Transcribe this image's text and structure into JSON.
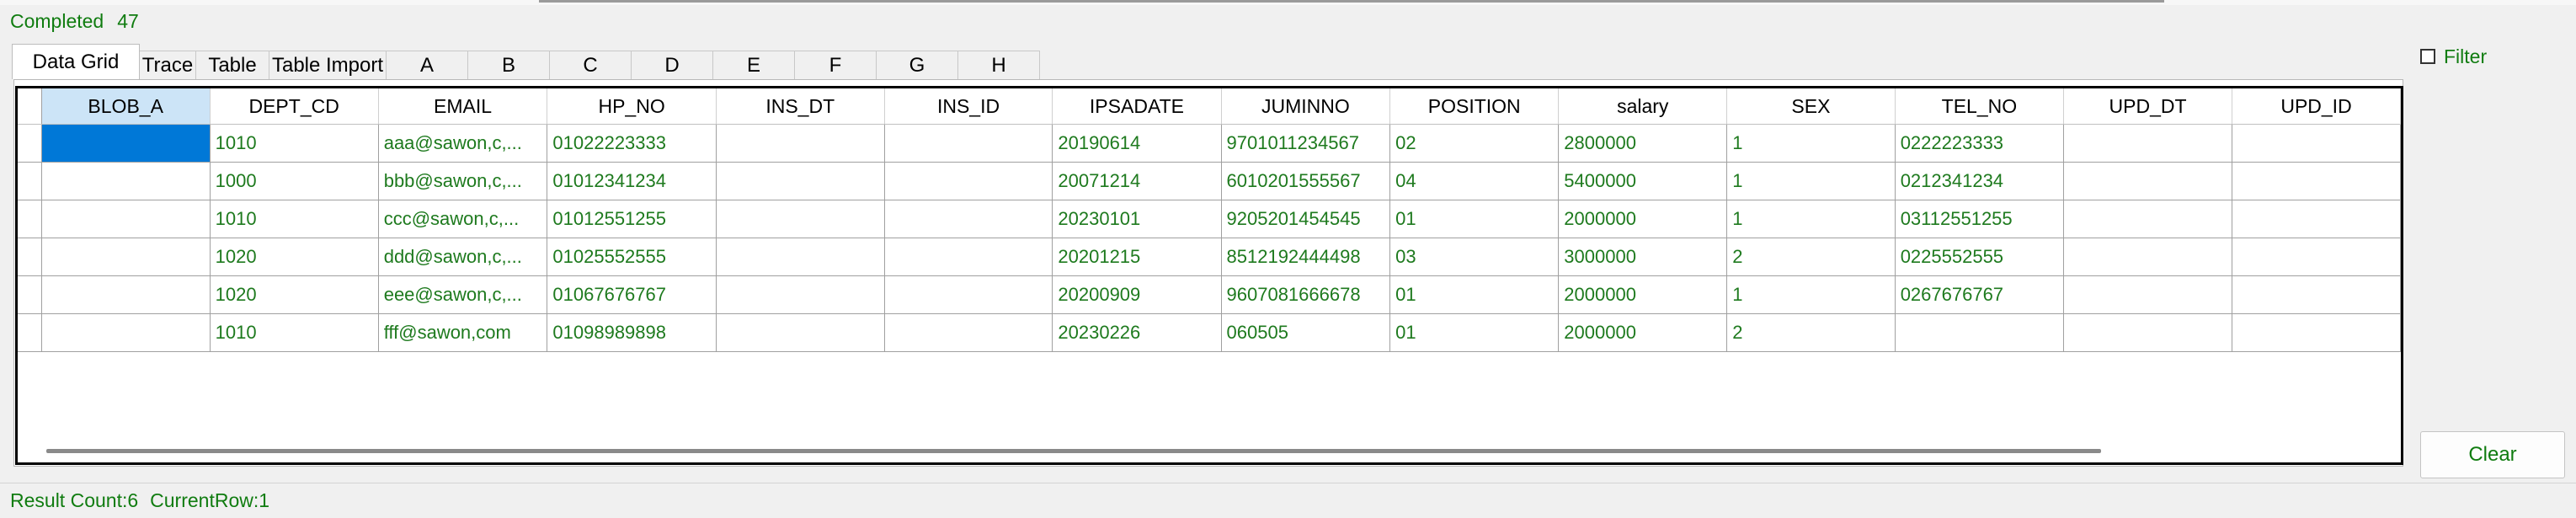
{
  "status_top": {
    "state": "Completed",
    "count": "47"
  },
  "tabs": [
    "Data Grid",
    "Trace",
    "Table",
    "Table Import",
    "A",
    "B",
    "C",
    "D",
    "E",
    "F",
    "G",
    "H"
  ],
  "active_tab": "Data Grid",
  "filter": {
    "label": "Filter",
    "checked": false
  },
  "grid": {
    "columns": [
      "BLOB_A",
      "DEPT_CD",
      "EMAIL",
      "HP_NO",
      "INS_DT",
      "INS_ID",
      "IPSADATE",
      "JUMINNO",
      "POSITION",
      "salary",
      "SEX",
      "TEL_NO",
      "UPD_DT",
      "UPD_ID"
    ],
    "rows": [
      [
        "",
        "1010",
        "aaa@sawon,c,...",
        "01022223333",
        "",
        "",
        "20190614",
        "9701011234567",
        "02",
        "2800000",
        "1",
        "0222223333",
        "",
        ""
      ],
      [
        "",
        "1000",
        "bbb@sawon,c,...",
        "01012341234",
        "",
        "",
        "20071214",
        "6010201555567",
        "04",
        "5400000",
        "1",
        "0212341234",
        "",
        ""
      ],
      [
        "",
        "1010",
        "ccc@sawon,c,...",
        "01012551255",
        "",
        "",
        "20230101",
        "9205201454545",
        "01",
        "2000000",
        "1",
        "03112551255",
        "",
        ""
      ],
      [
        "",
        "1020",
        "ddd@sawon,c,...",
        "01025552555",
        "",
        "",
        "20201215",
        "8512192444498",
        "03",
        "3000000",
        "2",
        "0225552555",
        "",
        ""
      ],
      [
        "",
        "1020",
        "eee@sawon,c,...",
        "01067676767",
        "",
        "",
        "20200909",
        "9607081666678",
        "01",
        "2000000",
        "1",
        "0267676767",
        "",
        ""
      ],
      [
        "",
        "1010",
        "fff@sawon,com",
        "01098989898",
        "",
        "",
        "20230226",
        "060505",
        "01",
        "2000000",
        "2",
        "",
        "",
        ""
      ]
    ]
  },
  "clear_button": "Clear",
  "status_bottom": {
    "result_count": "Result Count:6",
    "current_row": "CurrentRow:1"
  }
}
